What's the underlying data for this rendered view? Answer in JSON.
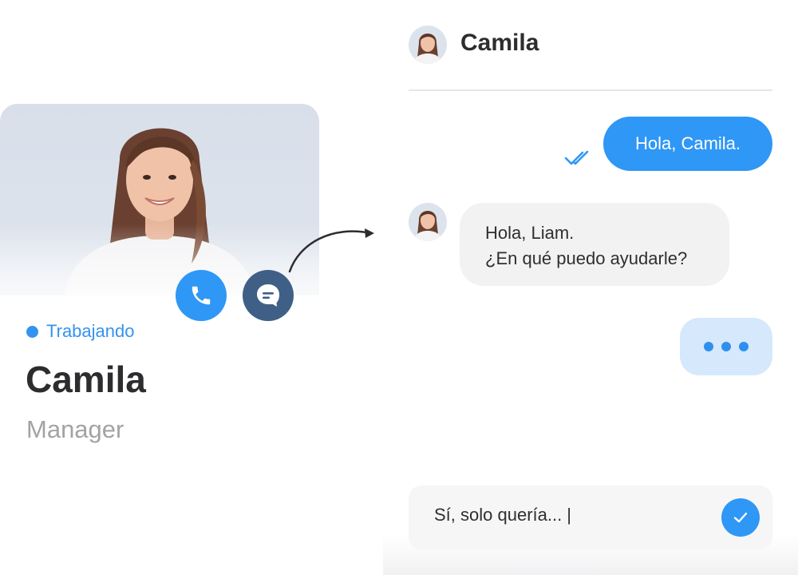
{
  "profile": {
    "status_label": "Trabajando",
    "status_color": "#3493f0",
    "name": "Camila",
    "role": "Manager",
    "call_icon": "phone-icon",
    "chat_icon": "chat-icon"
  },
  "chat": {
    "contact_name": "Camila",
    "messages": [
      {
        "direction": "outgoing",
        "text": "Hola, Camila.",
        "status": "read"
      },
      {
        "direction": "incoming",
        "lines": [
          "Hola, Liam.",
          "¿En qué puedo ayudarle?"
        ]
      }
    ],
    "typing_indicator": true,
    "composer": {
      "value": "Sí, solo quería... |",
      "send_icon": "checkmark-icon"
    }
  },
  "colors": {
    "accent": "#2f97f5",
    "chat_button": "#3f5f86",
    "incoming_bubble": "#f2f2f3",
    "typing_bubble": "#d6e8fb"
  }
}
